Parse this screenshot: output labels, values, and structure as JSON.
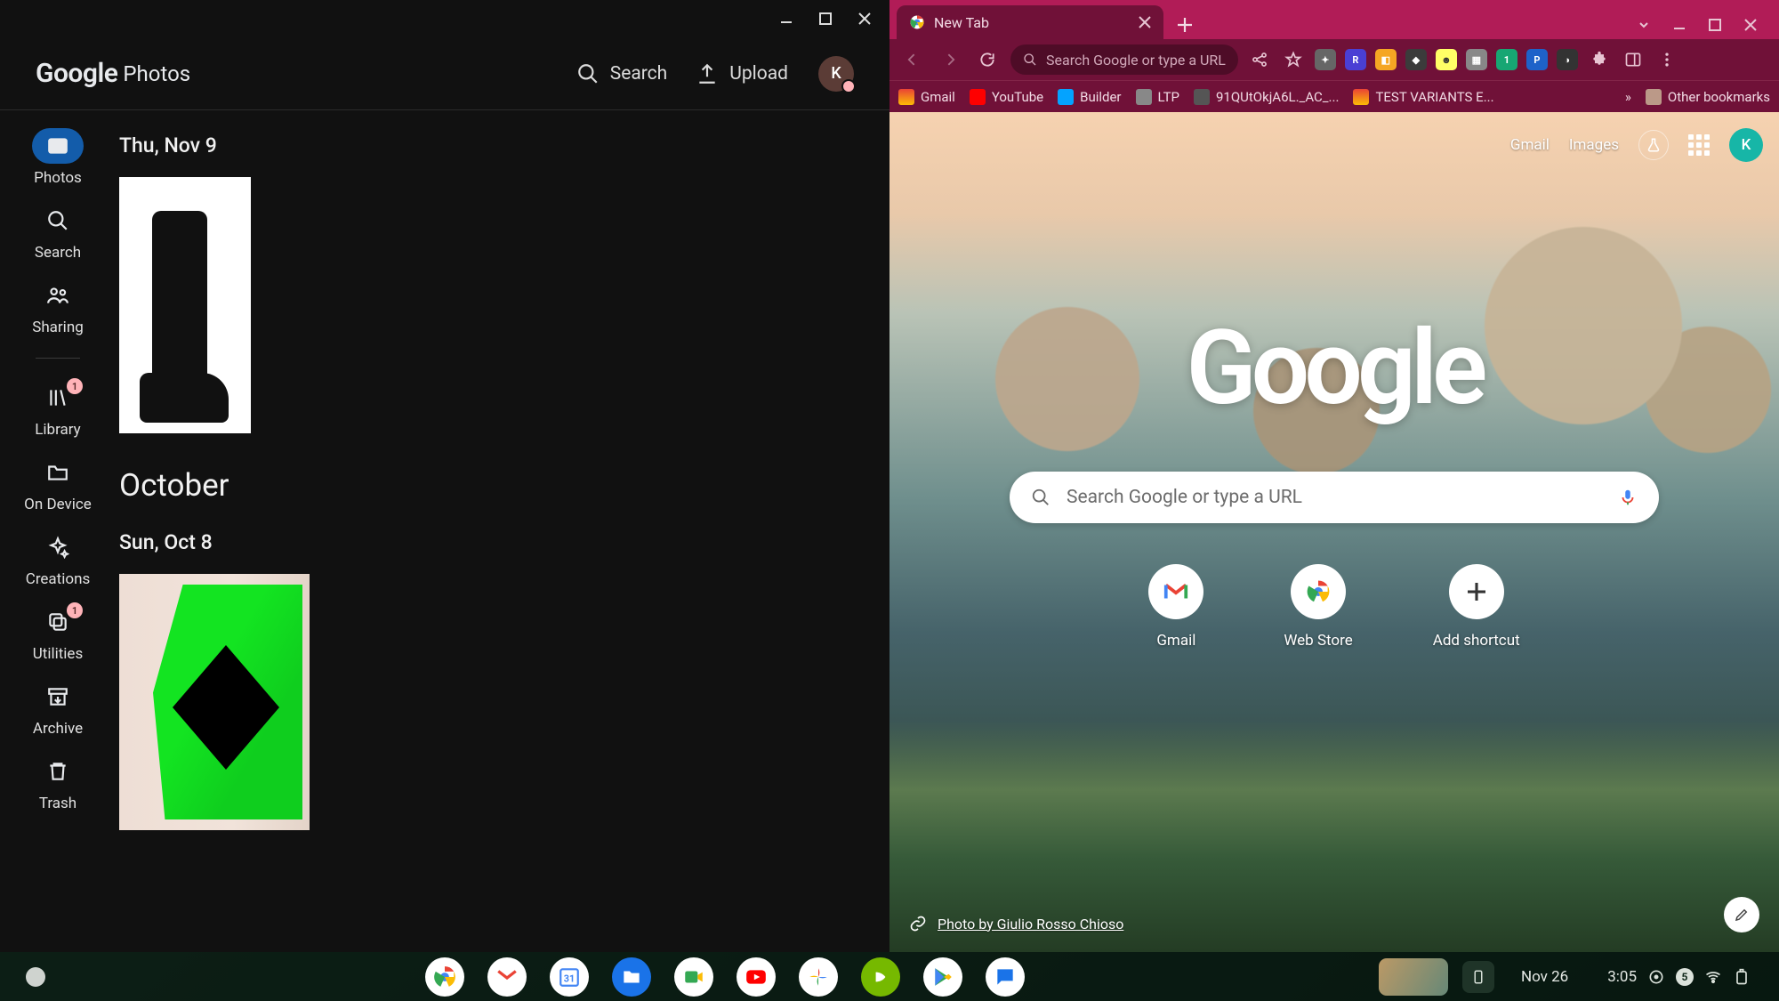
{
  "photos_app": {
    "logo": {
      "word1": "Google",
      "word2": "Photos"
    },
    "header_buttons": {
      "search": "Search",
      "upload": "Upload"
    },
    "avatar_letter": "K",
    "sidebar": [
      {
        "id": "photos",
        "label": "Photos",
        "active": true
      },
      {
        "id": "search",
        "label": "Search"
      },
      {
        "id": "sharing",
        "label": "Sharing"
      },
      {
        "id": "library",
        "label": "Library",
        "badge": "1"
      },
      {
        "id": "ondevice",
        "label": "On Device"
      },
      {
        "id": "creations",
        "label": "Creations"
      },
      {
        "id": "utilities",
        "label": "Utilities",
        "badge": "1"
      },
      {
        "id": "archive",
        "label": "Archive"
      },
      {
        "id": "trash",
        "label": "Trash"
      }
    ],
    "timeline": {
      "date1": "Thu, Nov 9",
      "month": "October",
      "date2": "Sun, Oct 8"
    }
  },
  "chrome": {
    "tab": {
      "title": "New Tab"
    },
    "omnibox_placeholder": "Search Google or type a URL",
    "bookmarks": [
      {
        "label": "Gmail",
        "color": "#ea4335"
      },
      {
        "label": "YouTube",
        "color": "#ff0000"
      },
      {
        "label": "Builder",
        "color": "#04a3ff"
      },
      {
        "label": "LTP",
        "color": "#888"
      },
      {
        "label": "91QUtOkjA6L._AC_...",
        "color": "#555"
      },
      {
        "label": "TEST VARIANTS E...",
        "color": "#ea4335"
      }
    ],
    "bookmarks_overflow": "»",
    "other_bookmarks": "Other bookmarks",
    "ntp": {
      "links": {
        "gmail": "Gmail",
        "images": "Images"
      },
      "logo": "Google",
      "search_placeholder": "Search Google or type a URL",
      "avatar_letter": "K",
      "shortcuts": [
        {
          "label": "Gmail"
        },
        {
          "label": "Web Store"
        },
        {
          "label": "Add shortcut"
        }
      ],
      "attribution": "Photo by Giulio Rosso Chioso"
    }
  },
  "shelf": {
    "date": "Nov 26",
    "time": "3:05",
    "notification_count": "5"
  }
}
